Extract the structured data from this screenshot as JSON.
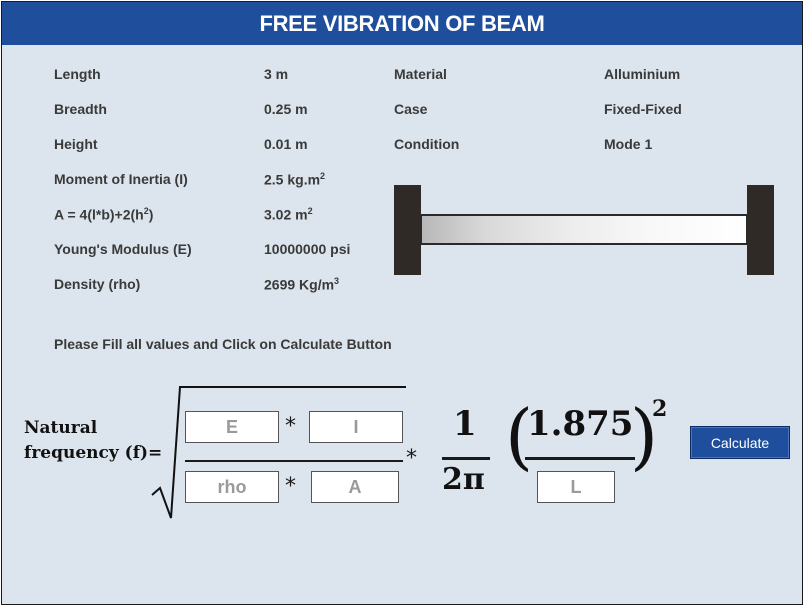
{
  "title": "FREE VIBRATION OF BEAM",
  "properties": {
    "length": {
      "label": "Length",
      "value": "3 m"
    },
    "breadth": {
      "label": "Breadth",
      "value": "0.25 m"
    },
    "height": {
      "label": "Height",
      "value": "0.01 m"
    },
    "inertia": {
      "label": "Moment of Inertia (I)",
      "value": "2.5 kg.m",
      "value_sup": "2"
    },
    "area": {
      "label_pre": "A = 4(l*b)+2(h",
      "label_sup": "2",
      "label_post": ")",
      "value": "3.02 m",
      "value_sup": "2"
    },
    "youngs": {
      "label": "Young's Modulus (E)",
      "value": "10000000 psi"
    },
    "density": {
      "label": "Density (rho)",
      "value": "2699 Kg/m",
      "value_sup": "3"
    }
  },
  "settings": {
    "material": {
      "label": "Material",
      "value": "Alluminium"
    },
    "case": {
      "label": "Case",
      "value": "Fixed-Fixed"
    },
    "condition": {
      "label": "Condition",
      "value": "Mode 1"
    }
  },
  "instruction": "Please Fill all values and Click on Calculate Button",
  "formula": {
    "label_line1": "Natural",
    "label_line2": "frequency (f)=",
    "op_multiply": "*",
    "one": "1",
    "two_pi": "2π",
    "coef": "1.875",
    "exponent": "2",
    "lparen": "(",
    "rparen": ")",
    "inputs": {
      "E": "E",
      "I": "I",
      "rho": "rho",
      "A": "A",
      "L": "L"
    }
  },
  "button": {
    "calculate": "Calculate"
  },
  "colors": {
    "header": "#1f4e9c",
    "background": "#dce4ed",
    "button": "#1f4e9c"
  }
}
